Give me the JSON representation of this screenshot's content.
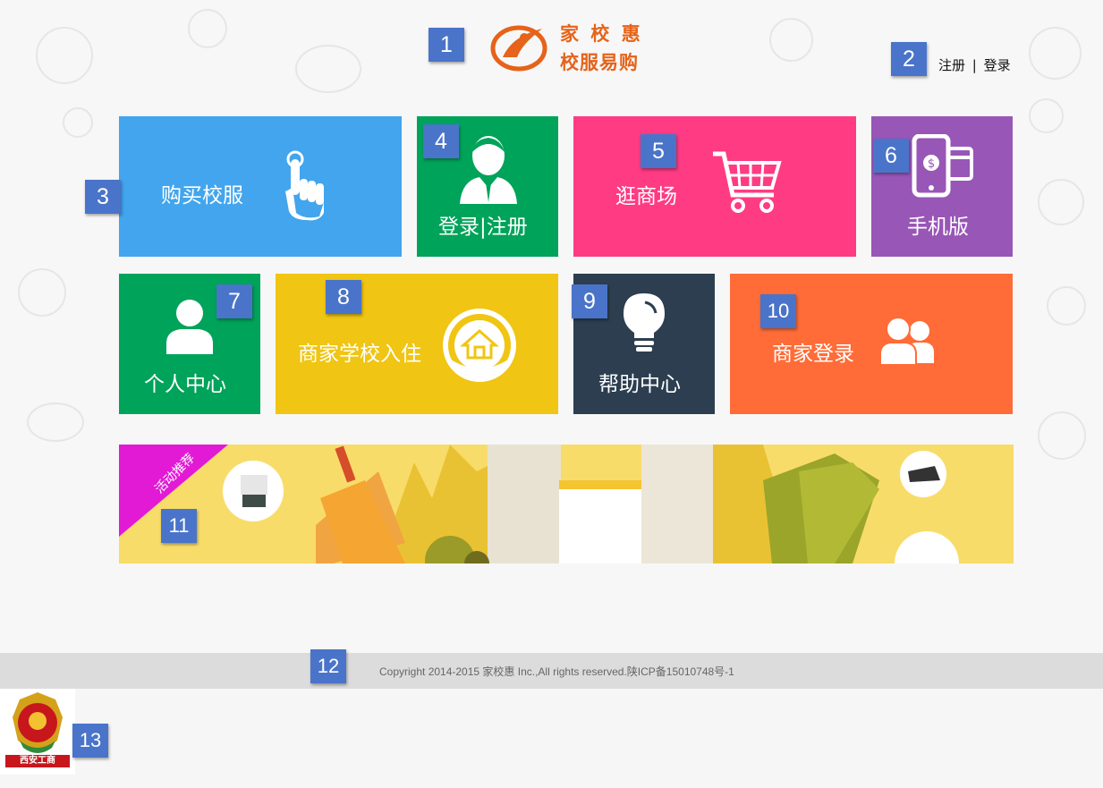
{
  "header": {
    "logo_line1": "家 校 惠",
    "logo_line2": "校服易购",
    "auth_register": "注册",
    "auth_separator": "|",
    "auth_login": "登录"
  },
  "tiles": [
    {
      "label": "购买校服",
      "color": "#42a5ed",
      "icon": "hand-pointer-icon"
    },
    {
      "label": "登录|注册",
      "color": "#00a35a",
      "icon": "user-suit-icon"
    },
    {
      "label": "逛商场",
      "color": "#fe3b83",
      "icon": "shopping-cart-icon"
    },
    {
      "label": "手机版",
      "color": "#9856b6",
      "icon": "mobile-payment-icon"
    },
    {
      "label": "个人中心",
      "color": "#00a35a",
      "icon": "person-icon"
    },
    {
      "label": "商家学校入住",
      "color": "#f0c513",
      "icon": "house-circle-icon"
    },
    {
      "label": "帮助中心",
      "color": "#2c3e50",
      "icon": "lightbulb-icon"
    },
    {
      "label": "商家登录",
      "color": "#ff6c37",
      "icon": "users-icon"
    }
  ],
  "banner": {
    "ribbon_text": "活动推荐",
    "ribbon_color": "#e21ad6"
  },
  "footer": {
    "copyright": "Copyright 2014-2015 家校惠 Inc.,All rights reserved.陕ICP备15010748号-1"
  },
  "seal": {
    "label": "西安工商"
  },
  "badges": [
    "1",
    "2",
    "3",
    "4",
    "5",
    "6",
    "7",
    "8",
    "9",
    "10",
    "11",
    "12",
    "13"
  ]
}
